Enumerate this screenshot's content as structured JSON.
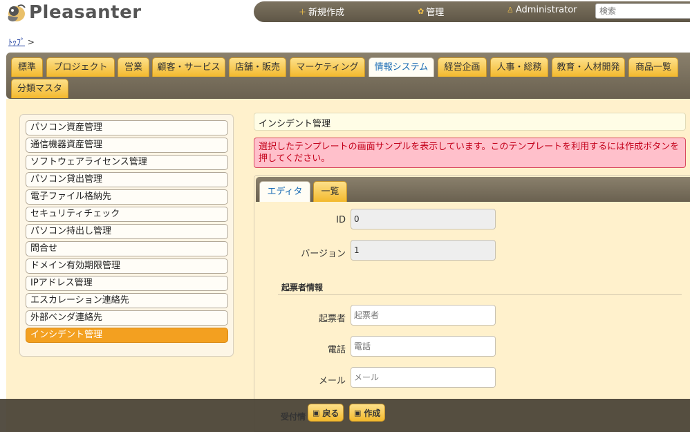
{
  "header": {
    "logo_text": "Pleasanter",
    "nav": {
      "new_label": "新規作成",
      "admin_label": "管理",
      "user_label": "Administrator"
    },
    "search_placeholder": "検索"
  },
  "breadcrumb": {
    "top_label": "ﾄｯﾌﾟ",
    "separator": ">"
  },
  "site_tabs": [
    {
      "label": "標準",
      "active": false
    },
    {
      "label": "プロジェクト",
      "active": false
    },
    {
      "label": "営業",
      "active": false
    },
    {
      "label": "顧客・サービス",
      "active": false
    },
    {
      "label": "店舗・販売",
      "active": false
    },
    {
      "label": "マーケティング",
      "active": false
    },
    {
      "label": "情報システム",
      "active": true
    },
    {
      "label": "経営企画",
      "active": false
    },
    {
      "label": "人事・総務",
      "active": false
    },
    {
      "label": "教育・人材開発",
      "active": false
    },
    {
      "label": "商品一覧",
      "active": false
    },
    {
      "label": "分類マスタ",
      "active": false
    }
  ],
  "left_list": [
    {
      "label": "パソコン資産管理",
      "active": false
    },
    {
      "label": "通信機器資産管理",
      "active": false
    },
    {
      "label": "ソフトウェアライセンス管理",
      "active": false
    },
    {
      "label": "パソコン貸出管理",
      "active": false
    },
    {
      "label": "電子ファイル格納先",
      "active": false
    },
    {
      "label": "セキュリティチェック",
      "active": false
    },
    {
      "label": "パソコン持出し管理",
      "active": false
    },
    {
      "label": "問合せ",
      "active": false
    },
    {
      "label": "ドメイン有効期限管理",
      "active": false
    },
    {
      "label": "IPアドレス管理",
      "active": false
    },
    {
      "label": "エスカレーション連絡先",
      "active": false
    },
    {
      "label": "外部ベンダ連絡先",
      "active": false
    },
    {
      "label": "インシデント管理",
      "active": true
    }
  ],
  "title": "インシデント管理",
  "alert": "選択したテンプレートの画面サンプルを表示しています。このテンプレートを利用するには作成ボタンを押してください。",
  "editor_tabs": [
    {
      "label": "エディタ",
      "active": true
    },
    {
      "label": "一覧",
      "active": false
    }
  ],
  "fields": {
    "id": {
      "label": "ID",
      "value": "0"
    },
    "version": {
      "label": "バージョン",
      "value": "1"
    },
    "section_creator": "起票者情報",
    "creator": {
      "label": "起票者",
      "placeholder": "起票者"
    },
    "phone": {
      "label": "電話",
      "placeholder": "電話"
    },
    "mail": {
      "label": "メール",
      "placeholder": "メール"
    },
    "section_reception": "受付情"
  },
  "buttons": {
    "back": "戻る",
    "create": "作成"
  },
  "colors": {
    "accent_orange": "#f3a020",
    "alert_red": "#c4001a",
    "link_blue": "#1a6cb5",
    "panel_bg": "#fff1cc"
  }
}
